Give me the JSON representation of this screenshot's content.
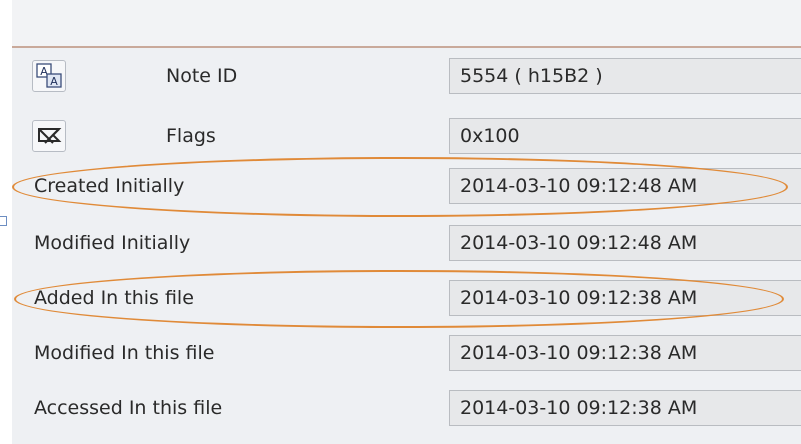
{
  "properties": {
    "note_id": {
      "label": "Note ID",
      "value": "5554 ( h15B2 )",
      "icon": "font-aa-icon"
    },
    "flags": {
      "label": "Flags",
      "value": "0x100",
      "icon": "flags-icon"
    },
    "rows": [
      {
        "label": "Created Initially",
        "value": "2014-03-10 09:12:48 AM",
        "highlighted": true
      },
      {
        "label": "Modified Initially",
        "value": "2014-03-10 09:12:48 AM",
        "highlighted": false
      },
      {
        "label": "Added In this file",
        "value": "2014-03-10 09:12:38 AM",
        "highlighted": true
      },
      {
        "label": "Modified In this file",
        "value": "2014-03-10 09:12:38 AM",
        "highlighted": false
      },
      {
        "label": "Accessed In this file",
        "value": "2014-03-10 09:12:38 AM",
        "highlighted": false
      }
    ]
  },
  "colors": {
    "highlight": "#e08a38",
    "field_bg": "#e7e8ea",
    "panel_bg": "#eef0f3"
  }
}
